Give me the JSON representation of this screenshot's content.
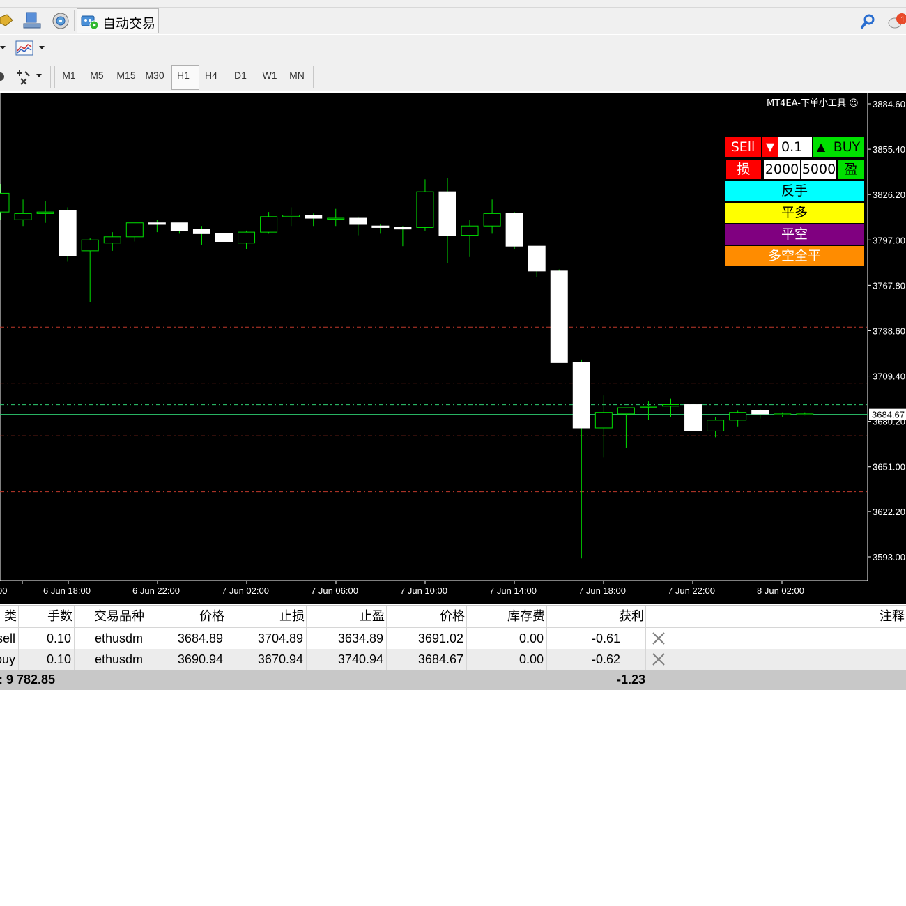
{
  "toolbar": {
    "auto_trade_label": "自动交易",
    "timeframes": [
      "M1",
      "M5",
      "M15",
      "M30",
      "H1",
      "H4",
      "D1",
      "W1",
      "MN"
    ],
    "active_timeframe": "H1",
    "notification_count": "1"
  },
  "chart": {
    "indicator_title": "MT4EA-下单小工具 ☺",
    "current_price": "3684.67",
    "price_labels": [
      "3884.60",
      "3855.40",
      "3826.20",
      "3797.00",
      "3767.80",
      "3738.60",
      "3709.40",
      "3680.20",
      "3651.00",
      "3622.20",
      "3593.00"
    ],
    "time_labels": [
      "00",
      "6 Jun 18:00",
      "6 Jun 22:00",
      "7 Jun 02:00",
      "7 Jun 06:00",
      "7 Jun 10:00",
      "7 Jun 14:00",
      "7 Jun 18:00",
      "7 Jun 22:00",
      "8 Jun 02:00"
    ],
    "colors": {
      "background": "#000000",
      "up": "#00e000",
      "down": "#ffffff",
      "level_red": "#c0392b",
      "level_green": "#2ecc71"
    }
  },
  "chart_data": {
    "type": "candlestick",
    "title": "",
    "xlabel": "",
    "ylabel": "",
    "ylim": [
      3580,
      3890
    ],
    "candles": [
      {
        "o": 3815.0,
        "h": 3833.0,
        "l": 3810.0,
        "c": 3827.0
      },
      {
        "o": 3810.0,
        "h": 3823.0,
        "l": 3806.0,
        "c": 3814.0
      },
      {
        "o": 3814.0,
        "h": 3822.0,
        "l": 3808.0,
        "c": 3815.0
      },
      {
        "o": 3816.0,
        "h": 3818.0,
        "l": 3783.0,
        "c": 3787.0
      },
      {
        "o": 3790.0,
        "h": 3798.0,
        "l": 3757.0,
        "c": 3797.0
      },
      {
        "o": 3795.0,
        "h": 3802.0,
        "l": 3790.0,
        "c": 3799.0
      },
      {
        "o": 3799.0,
        "h": 3808.0,
        "l": 3796.0,
        "c": 3808.0
      },
      {
        "o": 3808.0,
        "h": 3810.0,
        "l": 3802.0,
        "c": 3807.0
      },
      {
        "o": 3808.0,
        "h": 3808.0,
        "l": 3801.0,
        "c": 3803.0
      },
      {
        "o": 3804.0,
        "h": 3806.0,
        "l": 3794.0,
        "c": 3801.0
      },
      {
        "o": 3801.0,
        "h": 3803.0,
        "l": 3788.0,
        "c": 3796.0
      },
      {
        "o": 3795.0,
        "h": 3803.0,
        "l": 3791.0,
        "c": 3802.0
      },
      {
        "o": 3802.0,
        "h": 3815.0,
        "l": 3801.0,
        "c": 3812.0
      },
      {
        "o": 3812.0,
        "h": 3818.0,
        "l": 3806.0,
        "c": 3813.0
      },
      {
        "o": 3813.0,
        "h": 3814.0,
        "l": 3806.0,
        "c": 3811.0
      },
      {
        "o": 3811.0,
        "h": 3817.0,
        "l": 3806.0,
        "c": 3811.0
      },
      {
        "o": 3811.0,
        "h": 3812.0,
        "l": 3800.0,
        "c": 3807.0
      },
      {
        "o": 3806.0,
        "h": 3807.0,
        "l": 3801.0,
        "c": 3805.0
      },
      {
        "o": 3805.0,
        "h": 3806.0,
        "l": 3793.0,
        "c": 3804.0
      },
      {
        "o": 3805.0,
        "h": 3836.0,
        "l": 3803.0,
        "c": 3828.0
      },
      {
        "o": 3828.0,
        "h": 3837.0,
        "l": 3782.0,
        "c": 3800.0
      },
      {
        "o": 3800.0,
        "h": 3810.0,
        "l": 3786.0,
        "c": 3806.0
      },
      {
        "o": 3806.0,
        "h": 3823.0,
        "l": 3801.0,
        "c": 3814.0
      },
      {
        "o": 3814.0,
        "h": 3815.0,
        "l": 3791.0,
        "c": 3793.0
      },
      {
        "o": 3793.0,
        "h": 3793.0,
        "l": 3773.0,
        "c": 3777.0
      },
      {
        "o": 3777.0,
        "h": 3778.0,
        "l": 3718.0,
        "c": 3718.0
      },
      {
        "o": 3718.0,
        "h": 3720.0,
        "l": 3592.0,
        "c": 3676.0
      },
      {
        "o": 3676.0,
        "h": 3697.0,
        "l": 3657.0,
        "c": 3686.0
      },
      {
        "o": 3685.0,
        "h": 3689.0,
        "l": 3663.0,
        "c": 3689.0
      },
      {
        "o": 3690.0,
        "h": 3693.0,
        "l": 3681.0,
        "c": 3690.0
      },
      {
        "o": 3690.0,
        "h": 3695.0,
        "l": 3683.0,
        "c": 3691.0
      },
      {
        "o": 3691.0,
        "h": 3692.0,
        "l": 3674.0,
        "c": 3674.0
      },
      {
        "o": 3674.0,
        "h": 3683.0,
        "l": 3670.0,
        "c": 3681.0
      },
      {
        "o": 3681.0,
        "h": 3687.0,
        "l": 3677.0,
        "c": 3686.0
      },
      {
        "o": 3687.0,
        "h": 3688.0,
        "l": 3682.0,
        "c": 3685.0
      },
      {
        "o": 3685.0,
        "h": 3686.0,
        "l": 3683.0,
        "c": 3685.0
      },
      {
        "o": 3685.0,
        "h": 3686.0,
        "l": 3684.0,
        "c": 3685.0
      }
    ],
    "levels": [
      {
        "price": 3740.94,
        "style": "red-dash"
      },
      {
        "price": 3704.89,
        "style": "red-dash"
      },
      {
        "price": 3690.94,
        "style": "green-dash"
      },
      {
        "price": 3684.67,
        "style": "green-solid"
      },
      {
        "price": 3670.94,
        "style": "red-dash"
      },
      {
        "price": 3634.89,
        "style": "red-dash"
      }
    ]
  },
  "trade_panel": {
    "sell_label": "SEll",
    "lot_value": "0.1",
    "buy_label": "BUY",
    "sl_label": "损",
    "sl_value": "2000",
    "tp_value": "5000",
    "tp_label": "盈",
    "reverse_label": "反手",
    "close_long_label": "平多",
    "close_short_label": "平空",
    "close_all_label": "多空全平",
    "colors": {
      "sell": "#ff0000",
      "buy": "#00e000",
      "reverse": "#00ffff",
      "close_long": "#ffff00",
      "close_short": "#800080",
      "close_all": "#ff8c00"
    }
  },
  "orders": {
    "headers": [
      "类型",
      "手数",
      "交易品种",
      "价格",
      "止损",
      "止盈",
      "价格",
      "库存费",
      "获利",
      "注释"
    ],
    "rows": [
      [
        "sell",
        "0.10",
        "ethusdm",
        "3684.89",
        "3704.89",
        "3634.89",
        "3691.02",
        "0.00",
        "-0.61"
      ],
      [
        "buy",
        "0.10",
        "ethusdm",
        "3690.94",
        "3670.94",
        "3740.94",
        "3684.67",
        "0.00",
        "-0.62"
      ]
    ],
    "balance_text": ": 9 782.85",
    "total_profit": "-1.23"
  }
}
